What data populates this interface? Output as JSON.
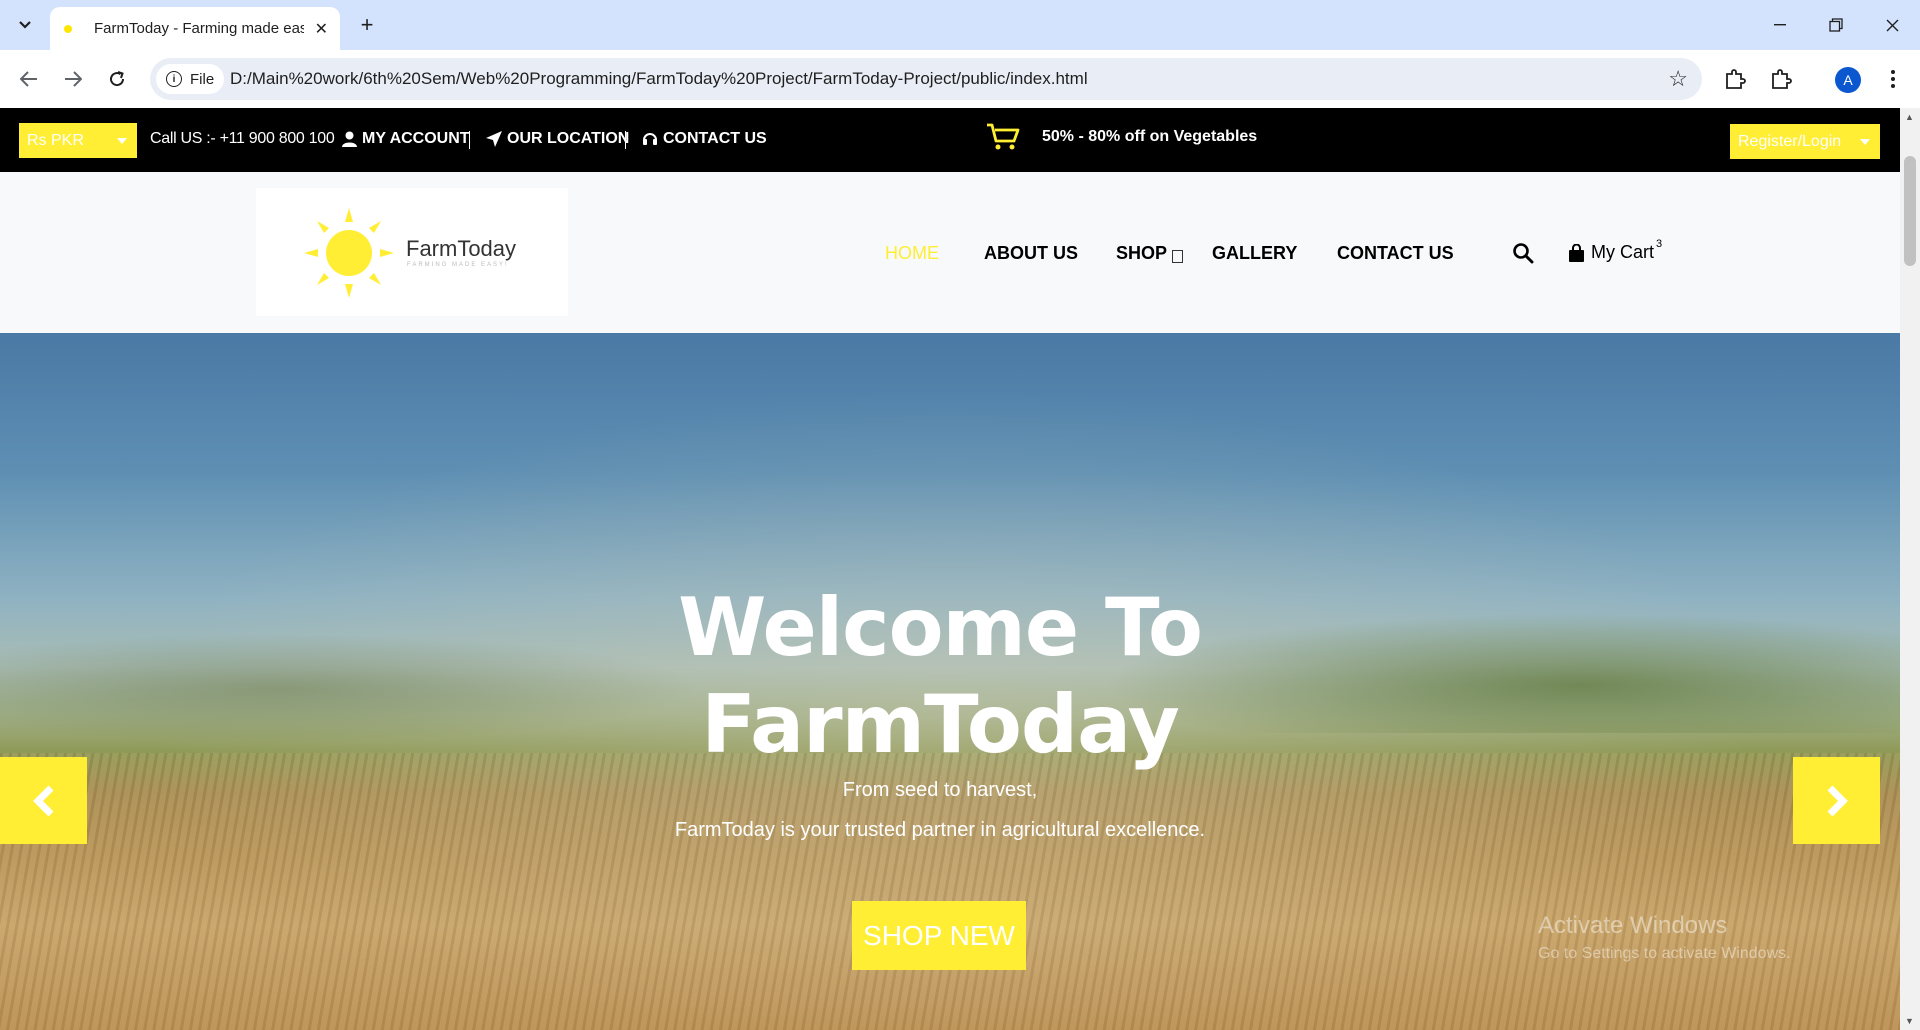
{
  "browser": {
    "tab_title": "FarmToday - Farming made eas",
    "new_tab": "+",
    "chip_label": "File",
    "url": "D:/Main%20work/6th%20Sem/Web%20Programming/FarmToday%20Project/FarmToday-Project/public/index.html",
    "profile_initial": "A"
  },
  "topbar": {
    "currency": "Rs PKR",
    "call": "Call US :- +11 900 800 100",
    "my_account": "MY ACCOUNT",
    "our_location": "OUR LOCATION",
    "contact_us": "CONTACT US",
    "promo": "50% - 80% off on Vegetables",
    "register": "Register/Login"
  },
  "logo": {
    "name": "FarmToday",
    "tagline": "FARMING MADE EASY!"
  },
  "nav": {
    "home": "HOME",
    "about": "ABOUT US",
    "shop": "SHOP",
    "gallery": "GALLERY",
    "contact": "CONTACT US",
    "cart_label": "My Cart",
    "cart_count": "3"
  },
  "hero": {
    "title_line1": "Welcome To",
    "title_line2": "FarmToday",
    "subtitle1": "From seed to harvest,",
    "subtitle2": "FarmToday is your trusted partner in agricultural excellence.",
    "button": "SHOP NEW"
  },
  "watermark": {
    "line1": "Activate Windows",
    "line2": "Go to Settings to activate Windows."
  },
  "colors": {
    "accent": "#ffee33",
    "topbar_bg": "#000000",
    "header_bg": "#f8f9fa"
  }
}
